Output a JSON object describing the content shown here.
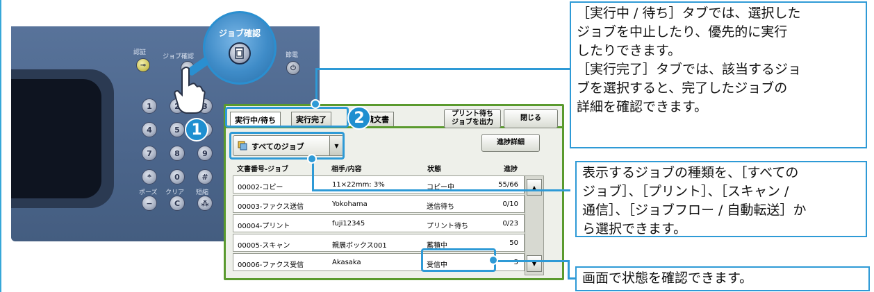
{
  "panel": {
    "auth_label": "認証",
    "job_status_label": "ジョブ確認",
    "power_save_label": "節電",
    "pause_label": "ポーズ",
    "clear_label": "クリア",
    "dial_label": "短縮",
    "keys": [
      "1",
      "2",
      "3",
      "4",
      "5",
      "6",
      "7",
      "8",
      "9",
      "*",
      "0",
      "#"
    ],
    "clear_key": "C",
    "magnifier_label": "ジョブ確認"
  },
  "steps": {
    "one": "1",
    "two": "2"
  },
  "screen": {
    "tabs": {
      "active": "実行中/待ち",
      "completed": "実行完了",
      "stored": "蓄積文書"
    },
    "print_waiting_button": "プリント待ち\nジョブを出力",
    "close_button": "閉じる",
    "filter_dropdown": "すべてのジョブ",
    "progress_detail_button": "進捗詳細",
    "columns": [
      "文書番号-ジョブ",
      "相手/内容",
      "状態",
      "進捗"
    ],
    "rows": [
      {
        "job": "00002-コピー",
        "content": "11×22mm: 3%",
        "status": "コピー中",
        "progress": "55/66"
      },
      {
        "job": "00003-ファクス送信",
        "content": "Yokohama",
        "status": "送信待ち",
        "progress": "0/10"
      },
      {
        "job": "00004-プリント",
        "content": "fuji12345",
        "status": "プリント待ち",
        "progress": "0/23"
      },
      {
        "job": "00005-スキャン",
        "content": "親展ボックス001",
        "status": "蓄積中",
        "progress": "50"
      },
      {
        "job": "00006-ファクス受信",
        "content": "Akasaka",
        "status": "受信中",
        "progress": "5"
      }
    ]
  },
  "callouts": {
    "tabs_line1": "［実行中 / 待ち］タブでは、選択した",
    "tabs_line2": "ジョブを中止したり、優先的に実行",
    "tabs_line3": "したりできます。",
    "tabs_line4": "［実行完了］タブでは、該当するジョ",
    "tabs_line5": "ブを選択すると、完了したジョブの",
    "tabs_line6": "詳細を確認できます。",
    "filter_line1": "表示するジョブの種類を、［すべての",
    "filter_line2": "ジョブ］、［プリント］、［スキャン /",
    "filter_line3": "通信］、［ジョブフロー / 自動転送］か",
    "filter_line4": "ら選択できます。",
    "status_line1": "画面で状態を確認できます。"
  },
  "colors": {
    "accent": "#2e9ad6",
    "panel": "#58739a",
    "screen_border": "#5a9a2e"
  }
}
